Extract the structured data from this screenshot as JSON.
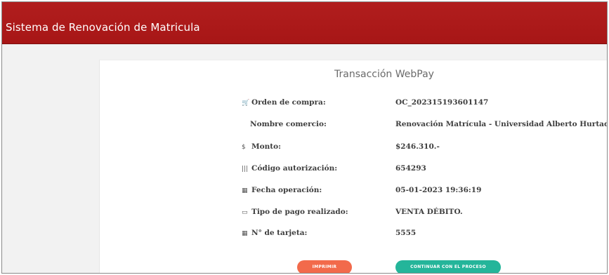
{
  "header": {
    "title": "Sistema de Renovación de Matricula"
  },
  "transaction": {
    "title": "Transacción WebPay",
    "rows": [
      {
        "icon": "cart-icon",
        "glyph": "🛒",
        "label": "Orden de compra:",
        "value": "OC_202315193601147"
      },
      {
        "icon": "",
        "glyph": "",
        "label": "Nombre comercio:",
        "value": "Renovación Matrícula - Universidad Alberto Hurtado"
      },
      {
        "icon": "dollar-icon",
        "glyph": "$",
        "label": "Monto:",
        "value": "$246.310.-"
      },
      {
        "icon": "barcode-icon",
        "glyph": "|||",
        "label": "Código autorización:",
        "value": "654293"
      },
      {
        "icon": "calendar-icon",
        "glyph": "▦",
        "label": "Fecha operación:",
        "value": "05-01-2023 19:36:19"
      },
      {
        "icon": "card-icon",
        "glyph": "▭",
        "label": "Tipo de pago realizado:",
        "value": "VENTA DÉBITO."
      },
      {
        "icon": "calendar-icon",
        "glyph": "▦",
        "label": "N° de tarjeta:",
        "value": "5555"
      }
    ]
  },
  "actions": {
    "print_label": "IMPRIMIR",
    "continue_label": "CONTINUAR CON EL PROCESO"
  },
  "colors": {
    "header_bg": "#a71616",
    "print_button": "#f26a4b",
    "continue_button": "#24b59a"
  }
}
